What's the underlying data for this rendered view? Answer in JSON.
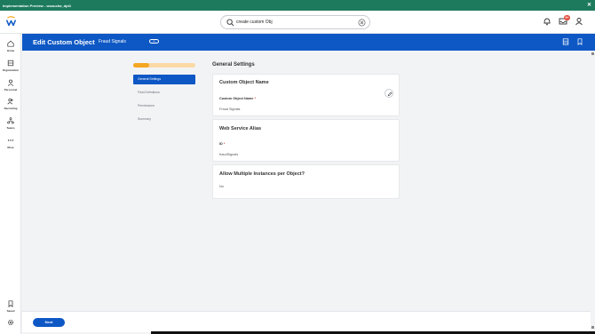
{
  "window": {
    "title": "Implementation Preview - wsoucha_dpt1",
    "close_glyph": "✕"
  },
  "topbar": {
    "logo": "workday-logo",
    "search": {
      "value": "create custom Obj",
      "icon": "search-icon",
      "clear_icon": "clear-circle-icon"
    },
    "notifications_icon": "bell-icon",
    "inbox_icon": "inbox-icon",
    "inbox_badge": "9+",
    "profile_icon": "user-icon"
  },
  "sidenav": {
    "items": [
      {
        "label": "Home",
        "icon": "home-icon"
      },
      {
        "label": "Organization",
        "icon": "organization-icon"
      },
      {
        "label": "Personnel",
        "icon": "person-icon"
      },
      {
        "label": "Recruiting",
        "icon": "recruiting-icon"
      },
      {
        "label": "Teams",
        "icon": "teams-icon"
      },
      {
        "label": "More",
        "icon": "more-dots-icon"
      }
    ],
    "saved": {
      "label": "Saved",
      "icon": "bookmark-icon"
    },
    "settings_icon": "settings-gear-icon"
  },
  "header": {
    "title": "Edit Custom Object",
    "subtitle": "Fraud Signals",
    "more_label": "•••",
    "actions": [
      "layout-icon",
      "bookmark-icon"
    ]
  },
  "wizard": {
    "progress": 0.25,
    "steps": [
      {
        "label": "General Settings",
        "active": true
      },
      {
        "label": "Field Definitions",
        "active": false
      },
      {
        "label": "Permissions",
        "active": false
      },
      {
        "label": "Summary",
        "active": false
      }
    ]
  },
  "main": {
    "section_title": "General Settings",
    "cards": {
      "object_name": {
        "title": "Custom Object Name",
        "field_label": "Custom Object Name",
        "required_mark": "*",
        "value": "Fraud Signals",
        "edit_icon": "pencil-icon"
      },
      "web_service": {
        "title": "Web Service Alias",
        "field_label": "ID",
        "required_mark": "*",
        "value": "fraudSignals"
      },
      "multiple_instances": {
        "title": "Allow Multiple Instances per Object?",
        "value": "No"
      }
    }
  },
  "footer": {
    "next_label": "Next"
  },
  "colors": {
    "brand_blue": "#0e58c5",
    "preview_bar": "#1d7a5d",
    "progress_fill": "#f5a623",
    "progress_track": "#fbd9a5",
    "badge": "#e24b3c"
  }
}
